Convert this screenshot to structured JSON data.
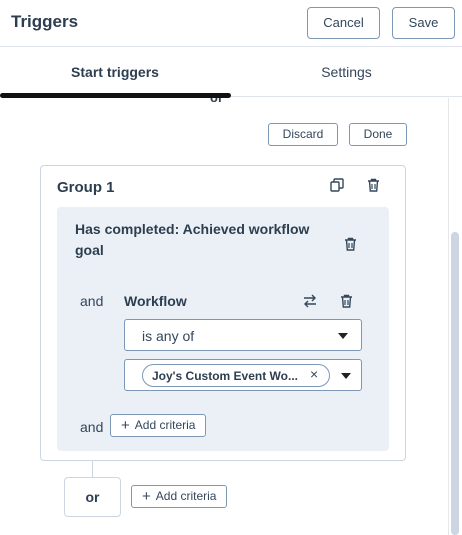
{
  "header": {
    "title": "Triggers",
    "cancel_label": "Cancel",
    "save_label": "Save"
  },
  "tabs": [
    {
      "label": "Start triggers",
      "active": true
    },
    {
      "label": "Settings",
      "active": false
    }
  ],
  "content": {
    "peek_text": "or",
    "discard_label": "Discard",
    "done_label": "Done",
    "group": {
      "title": "Group 1",
      "condition_title": "Has completed: Achieved workflow goal",
      "row_connector": "and",
      "field_label": "Workflow",
      "operator_value": "is any of",
      "selected_chip": "Joy's Custom Event Wo...",
      "inner_and_label": "and",
      "inner_add_criteria": "Add criteria"
    },
    "or_label": "or",
    "outer_add_criteria": "Add criteria"
  },
  "colors": {
    "text": "#33475b",
    "border": "#7c98b6",
    "panel_bg": "#eaf0f6",
    "active_tab_indicator": "#111111"
  },
  "icons": [
    "clone-icon",
    "trash-icon",
    "swap-icon",
    "close-icon",
    "caret-down-icon",
    "plus-icon"
  ]
}
